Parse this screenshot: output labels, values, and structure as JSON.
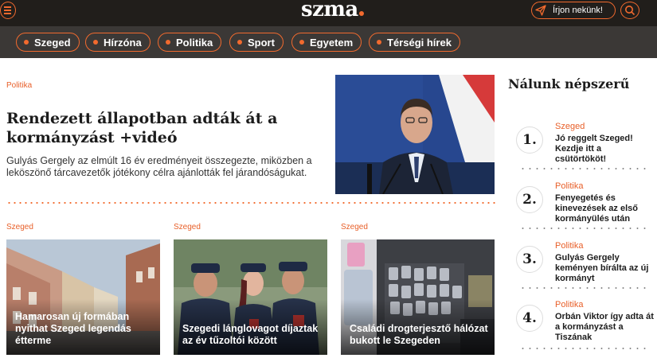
{
  "brand": {
    "logo": "szma",
    "accent": "#f26a2e",
    "dark": "#211e1b"
  },
  "header": {
    "write_label": "Írjon nekünk!"
  },
  "categories": [
    "Szeged",
    "Hírzóna",
    "Politika",
    "Sport",
    "Egyetem",
    "Térségi hírek"
  ],
  "main_article": {
    "kicker": "Politika",
    "title": "Rendezett állapotban adták át a kormányzást +videó",
    "lead": "Gulyás Gergely az elmúlt 16 év eredményeit összegezte, miközben a leköszönő tárcavezetők jótékony célra ajánlották fel járandóságukat."
  },
  "cards": [
    {
      "kicker": "Szeged",
      "title": "Hamarosan új formában nyithat Szeged legendás étterme"
    },
    {
      "kicker": "Szeged",
      "title": "Szegedi lánglovagot díjaztak az év tűzoltói között"
    },
    {
      "kicker": "Szeged",
      "title": "Családi drogterjesztő hálózat bukott le Szegeden"
    }
  ],
  "popular": {
    "title": "Nálunk népszerű",
    "items": [
      {
        "num": "1.",
        "cat": "Szeged",
        "text": "Jó reggelt Szeged! Kezdje itt a csütörtököt!"
      },
      {
        "num": "2.",
        "cat": "Politika",
        "text": "Fenyegetés és kinevezések az első kormányülés után"
      },
      {
        "num": "3.",
        "cat": "Politika",
        "text": "Gulyás Gergely keményen bírálta az új kormányt"
      },
      {
        "num": "4.",
        "cat": "Politika",
        "text": "Orbán Viktor így adta át a kormányzást a Tiszának"
      }
    ]
  }
}
